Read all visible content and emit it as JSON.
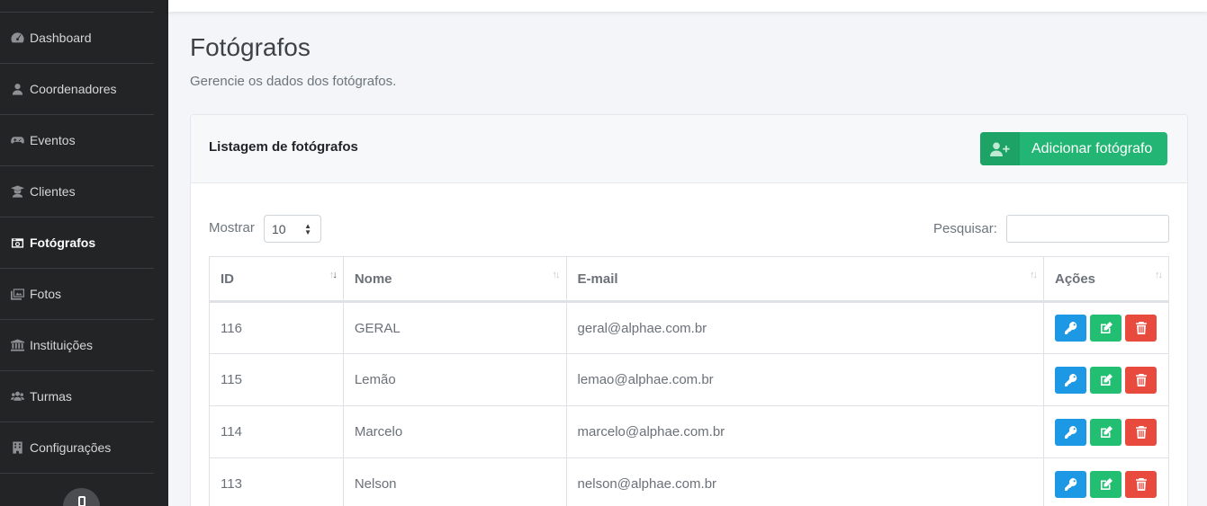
{
  "sidebar": {
    "items": [
      {
        "label": "Dashboard",
        "icon": "dashboard-icon"
      },
      {
        "label": "Coordenadores",
        "icon": "user-icon"
      },
      {
        "label": "Eventos",
        "icon": "gamepad-icon"
      },
      {
        "label": "Clientes",
        "icon": "graduate-icon"
      },
      {
        "label": "Fotógrafos",
        "icon": "camera-icon",
        "active": true
      },
      {
        "label": "Fotos",
        "icon": "images-icon"
      },
      {
        "label": "Instituições",
        "icon": "institution-icon"
      },
      {
        "label": "Turmas",
        "icon": "users-icon"
      },
      {
        "label": "Configurações",
        "icon": "building-icon"
      }
    ]
  },
  "header": {
    "title": "Fotógrafos",
    "subtitle": "Gerencie os dados dos fotógrafos."
  },
  "card": {
    "title": "Listagem de fotógrafos",
    "add_button": "Adicionar fotógrafo"
  },
  "controls": {
    "show_label": "Mostrar",
    "show_value": "10",
    "search_label": "Pesquisar:",
    "search_value": ""
  },
  "table": {
    "headers": [
      "ID",
      "Nome",
      "E-mail",
      "Ações"
    ],
    "rows": [
      {
        "id": "116",
        "name": "GERAL",
        "email": "geral@alphae.com.br"
      },
      {
        "id": "115",
        "name": "Lemão",
        "email": "lemao@alphae.com.br"
      },
      {
        "id": "114",
        "name": "Marcelo",
        "email": "marcelo@alphae.com.br"
      },
      {
        "id": "113",
        "name": "Nelson",
        "email": "nelson@alphae.com.br"
      }
    ]
  },
  "colors": {
    "sidebar_bg": "#222426",
    "primary_green": "#22b573",
    "key_blue": "#1d98e4",
    "edit_green": "#22bf73",
    "delete_red": "#e84a3d"
  }
}
